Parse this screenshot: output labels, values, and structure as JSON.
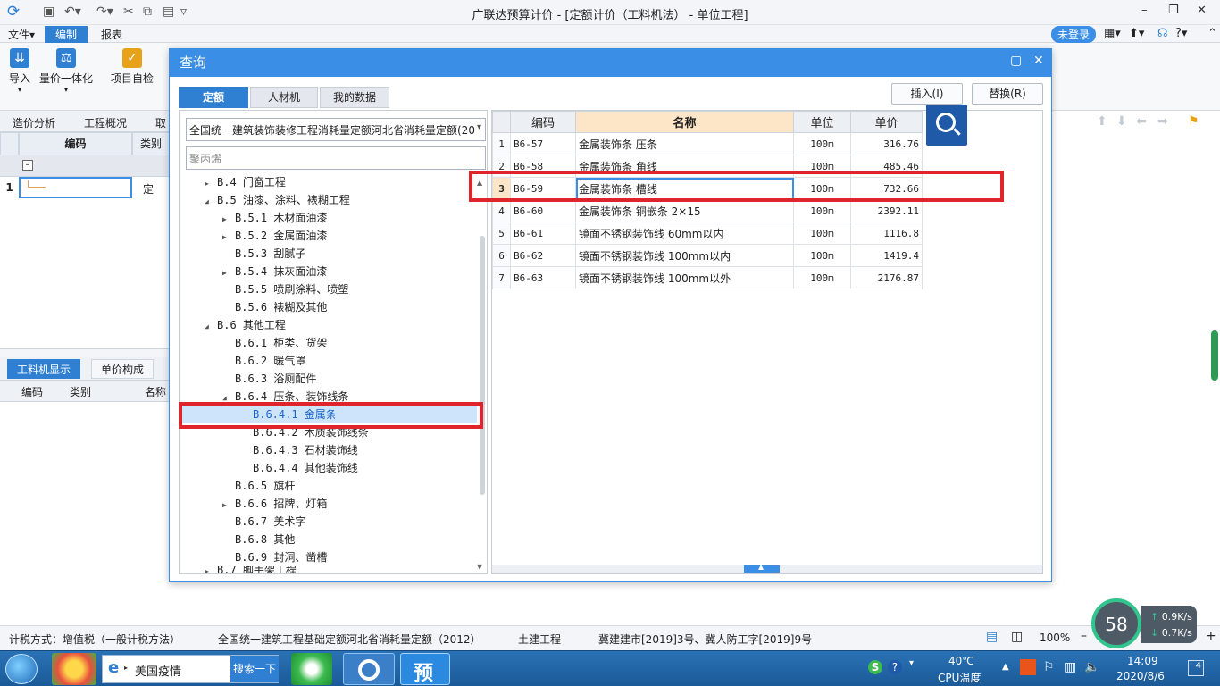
{
  "app": {
    "title": "广联达预算计价 - [定额计价（工料机法） - 单位工程]",
    "login": "未登录"
  },
  "menu": {
    "file": "文件▾",
    "edit": "编制",
    "report": "报表"
  },
  "ribbon": {
    "import": "导入",
    "unit_price": "量价一体化",
    "self_check": "项目自检"
  },
  "left_tabs": {
    "cost_analysis": "造价分析",
    "project_overview": "工程概况",
    "more": "取"
  },
  "left_grid": {
    "col_code": "编码",
    "col_type": "类别",
    "row_num": "1",
    "row_type": "定"
  },
  "bottom_tabs": {
    "labor": "工料机显示",
    "unit_comp": "单价构成",
    "col_code": "编码",
    "col_type": "类别",
    "col_name": "名称"
  },
  "dialog": {
    "title": "查询",
    "tabs": [
      "定额",
      "人材机",
      "我的数据"
    ],
    "insert": "插入(I)",
    "replace": "替换(R)",
    "combo_value": "全国统一建筑装饰装修工程消耗量定额河北省消耗量定额(20",
    "search_placeholder": "聚丙烯",
    "tree": [
      {
        "label": "B.4 门窗工程",
        "toggle": "▶"
      },
      {
        "label": "B.5 油漆、涂料、裱糊工程",
        "toggle": "◢"
      },
      {
        "label": "B.5.1 木材面油漆",
        "toggle": "▶"
      },
      {
        "label": "B.5.2 金属面油漆",
        "toggle": "▶"
      },
      {
        "label": "B.5.3 刮腻子",
        "toggle": ""
      },
      {
        "label": "B.5.4 抹灰面油漆",
        "toggle": "▶"
      },
      {
        "label": "B.5.5 喷刷涂料、喷塑",
        "toggle": ""
      },
      {
        "label": "B.5.6 裱糊及其他",
        "toggle": ""
      },
      {
        "label": "B.6 其他工程",
        "toggle": "◢"
      },
      {
        "label": "B.6.1 柜类、货架",
        "toggle": ""
      },
      {
        "label": "B.6.2 暖气罩",
        "toggle": ""
      },
      {
        "label": "B.6.3 浴厕配件",
        "toggle": ""
      },
      {
        "label": "B.6.4 压条、装饰线条",
        "toggle": "◢"
      },
      {
        "label": "B.6.4.1 金属条",
        "toggle": ""
      },
      {
        "label": "B.6.4.2 木质装饰线条",
        "toggle": ""
      },
      {
        "label": "B.6.4.3 石材装饰线",
        "toggle": ""
      },
      {
        "label": "B.6.4.4 其他装饰线",
        "toggle": ""
      },
      {
        "label": "B.6.5 旗杆",
        "toggle": ""
      },
      {
        "label": "B.6.6 招牌、灯箱",
        "toggle": "▶"
      },
      {
        "label": "B.6.7 美术字",
        "toggle": ""
      },
      {
        "label": "B.6.8 其他",
        "toggle": ""
      },
      {
        "label": "B.6.9 封洞、凿槽",
        "toggle": ""
      },
      {
        "label": "B.7 脚手架工程",
        "toggle": "▶"
      }
    ],
    "grid": {
      "headers": [
        "编码",
        "名称",
        "单位",
        "单价"
      ],
      "rows": [
        {
          "no": "1",
          "code": "B6-57",
          "name": "金属装饰条 压条",
          "unit": "100m",
          "price": "316.76"
        },
        {
          "no": "2",
          "code": "B6-58",
          "name": "金属装饰条 角线",
          "unit": "100m",
          "price": "485.46"
        },
        {
          "no": "3",
          "code": "B6-59",
          "name": "金属装饰条 槽线",
          "unit": "100m",
          "price": "732.66"
        },
        {
          "no": "4",
          "code": "B6-60",
          "name": "金属装饰条 铜嵌条 2×15",
          "unit": "100m",
          "price": "2392.11"
        },
        {
          "no": "5",
          "code": "B6-61",
          "name": "镜面不锈钢装饰线 60mm以内",
          "unit": "100m",
          "price": "1116.8"
        },
        {
          "no": "6",
          "code": "B6-62",
          "name": "镜面不锈钢装饰线 100mm以内",
          "unit": "100m",
          "price": "1419.4"
        },
        {
          "no": "7",
          "code": "B6-63",
          "name": "镜面不锈钢装饰线 100mm以外",
          "unit": "100m",
          "price": "2176.87"
        }
      ]
    }
  },
  "status": {
    "tax": "计税方式：增值税（一般计税方法）",
    "norm": "全国统一建筑工程基础定额河北省消耗量定额（2012）",
    "category": "土建工程",
    "doc": "冀建建市[2019]3号、冀人防工字[2019]9号",
    "zoom": "100%"
  },
  "net": {
    "percent": "58",
    "up": "0.9K/s",
    "down": "0.7K/s"
  },
  "taskbar": {
    "search_text": "美国疫情",
    "search_btn": "搜索一下",
    "app_label": "预",
    "temp": "40℃",
    "temp_label": "CPU温度",
    "time": "14:09",
    "date": "2020/8/6"
  }
}
